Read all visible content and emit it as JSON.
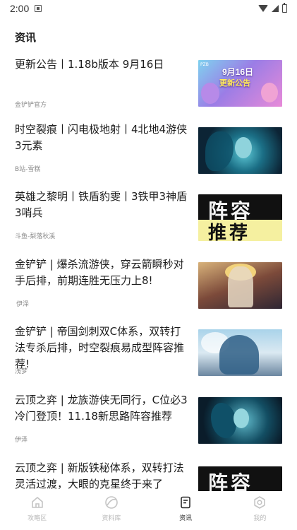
{
  "status_bar": {
    "time": "2:00"
  },
  "page": {
    "title": "资讯"
  },
  "news": [
    {
      "title": "更新公告丨1.18b版本 9月16日",
      "source": "金铲铲官方",
      "thumb_text": [
        "9月16日",
        "更新公告"
      ],
      "thumb_tag": "PZB"
    },
    {
      "title": "时空裂痕丨闪电极地射丨4北地4游侠3元素",
      "source": "B站-雪糕"
    },
    {
      "title": "英雄之黎明丨铁盾豹雯丨3铁甲3神盾3哨兵",
      "source": "斗鱼-梨落秋溪",
      "thumb_text": [
        "阵容",
        "推荐"
      ]
    },
    {
      "title": "金铲铲 | 爆杀流游侠，穿云箭瞬秒对手后排，前期连胜无压力上8!",
      "source": "伊泽"
    },
    {
      "title": "金铲铲 | 帝国剑刺双C体系，双转打法专杀后排，时空裂痕易成型阵容推荐!",
      "source": "浅梦"
    },
    {
      "title": "云顶之弈 | 龙族游侠无同行，C位必3冷门登顶！11.18新思路阵容推荐",
      "source": "伊泽"
    },
    {
      "title": "云顶之弈 | 新版铁秘体系，双转打法灵活过渡，大眼的克星终于来了",
      "source": "",
      "thumb_text": [
        "阵容"
      ]
    }
  ],
  "tabs": [
    {
      "label": "攻略区",
      "icon": "home-icon",
      "active": false
    },
    {
      "label": "资料库",
      "icon": "disc-icon",
      "active": false
    },
    {
      "label": "资讯",
      "icon": "document-icon",
      "active": true
    },
    {
      "label": "我的",
      "icon": "gear-icon",
      "active": false
    }
  ],
  "colors": {
    "active_tab": "#2a2a2a",
    "inactive_tab": "#b9b9b9",
    "source_text": "#8a8a8a"
  }
}
